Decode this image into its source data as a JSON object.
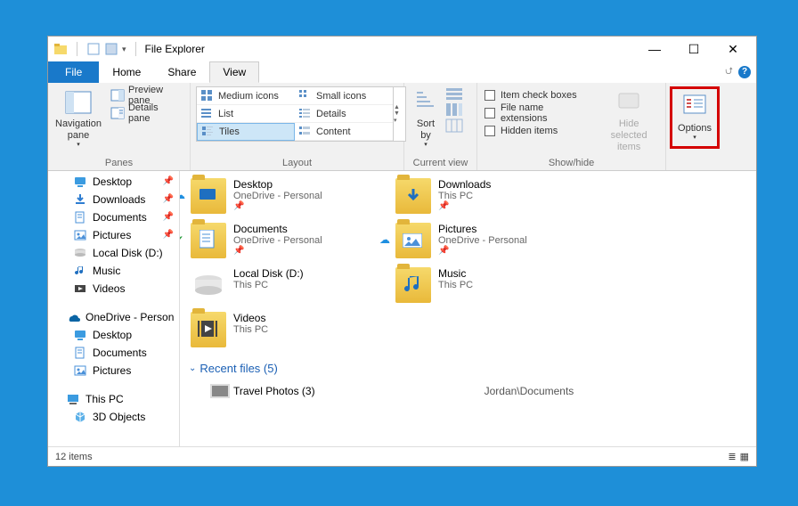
{
  "title": "File Explorer",
  "tabs": {
    "file": "File",
    "home": "Home",
    "share": "Share",
    "view": "View"
  },
  "ribbon": {
    "panes": {
      "label": "Panes",
      "nav": "Navigation\npane",
      "preview": "Preview pane",
      "details": "Details pane"
    },
    "layout": {
      "label": "Layout",
      "medium": "Medium icons",
      "small": "Small icons",
      "list": "List",
      "details": "Details",
      "tiles": "Tiles",
      "content": "Content"
    },
    "currentview": {
      "label": "Current view",
      "sort": "Sort\nby"
    },
    "showhide": {
      "label": "Show/hide",
      "checkboxes": "Item check boxes",
      "extensions": "File name extensions",
      "hidden": "Hidden items",
      "hidesel": "Hide selected\nitems"
    },
    "options": "Options"
  },
  "nav": [
    {
      "indent": 1,
      "icon": "desktop",
      "label": "Desktop",
      "pin": true
    },
    {
      "indent": 1,
      "icon": "downloads",
      "label": "Downloads",
      "pin": true
    },
    {
      "indent": 1,
      "icon": "documents",
      "label": "Documents",
      "pin": true
    },
    {
      "indent": 1,
      "icon": "pictures",
      "label": "Pictures",
      "pin": true
    },
    {
      "indent": 1,
      "icon": "disk",
      "label": "Local Disk (D:)"
    },
    {
      "indent": 1,
      "icon": "music",
      "label": "Music"
    },
    {
      "indent": 1,
      "icon": "videos",
      "label": "Videos"
    },
    {
      "spacer": true
    },
    {
      "indent": 0,
      "icon": "onedrive",
      "label": "OneDrive - Person"
    },
    {
      "indent": 1,
      "icon": "desktop",
      "label": "Desktop"
    },
    {
      "indent": 1,
      "icon": "documents",
      "label": "Documents"
    },
    {
      "indent": 1,
      "icon": "pictures",
      "label": "Pictures"
    },
    {
      "spacer": true
    },
    {
      "indent": 0,
      "icon": "thispc",
      "label": "This PC"
    },
    {
      "indent": 1,
      "icon": "3d",
      "label": "3D Objects"
    }
  ],
  "tiles": [
    {
      "status": "cloud",
      "icon": "desktop-folder",
      "name": "Desktop",
      "sub": "OneDrive - Personal",
      "pin": true
    },
    {
      "status": "",
      "icon": "downloads-folder",
      "name": "Downloads",
      "sub": "This PC",
      "pin": true
    },
    {
      "status": "check",
      "icon": "documents-folder",
      "name": "Documents",
      "sub": "OneDrive - Personal",
      "pin": true
    },
    {
      "status": "cloud",
      "icon": "pictures-folder",
      "name": "Pictures",
      "sub": "OneDrive - Personal",
      "pin": true
    },
    {
      "status": "",
      "icon": "disk",
      "name": "Local Disk (D:)",
      "sub": "This PC",
      "pin": false
    },
    {
      "status": "",
      "icon": "music-folder",
      "name": "Music",
      "sub": "This PC",
      "pin": false
    },
    {
      "status": "",
      "icon": "videos-folder",
      "name": "Videos",
      "sub": "This PC",
      "pin": false
    }
  ],
  "recent": {
    "heading": "Recent files (5)",
    "item_name": "Travel Photos (3)",
    "item_path": "Jordan\\Documents"
  },
  "status": {
    "count": "12 items"
  }
}
